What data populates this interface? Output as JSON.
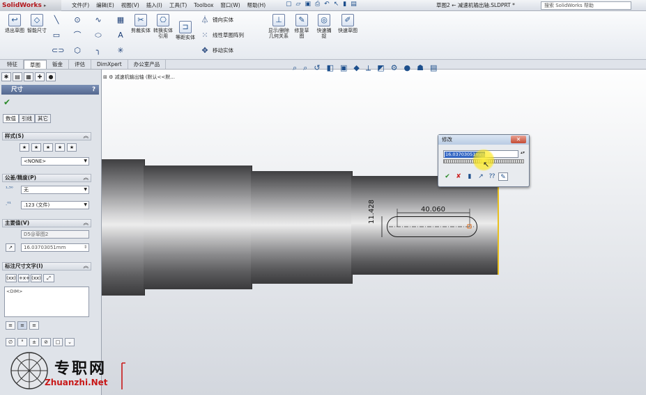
{
  "app": {
    "logo": "SolidWorks",
    "menus": [
      "文件(F)",
      "编辑(E)",
      "视图(V)",
      "插入(I)",
      "工具(T)",
      "Toolbox",
      "窗口(W)",
      "帮助(H)"
    ],
    "document_title": "草图2 ← 减速机输出轴.SLDPRT *",
    "search_placeholder": "搜索 SolidWorks 帮助"
  },
  "ribbon": {
    "exit_sketch": "退出草图",
    "smart_dimension": "智能尺寸",
    "trim": "剪裁实体",
    "convert": "转换实体引用",
    "offset": "等距实体",
    "mirror": "镜向实体",
    "linear_pattern": "线性草图阵列",
    "move": "移动实体",
    "display_relations": "显示/删除几何关系",
    "repair": "修复草图",
    "quick_snaps": "快速捕捉",
    "rapid_sketch": "快速草图"
  },
  "command_tabs": [
    "特征",
    "草图",
    "钣金",
    "评估",
    "DimXpert",
    "办公室产品"
  ],
  "panel": {
    "title": "尺寸",
    "help": "?",
    "subtabs": [
      "数值",
      "引线",
      "其它"
    ],
    "style_section": "样式(S)",
    "style_value": "<NONE>",
    "tolerance_section": "公差/精度(P)",
    "tolerance_type": "无",
    "precision": ".123 (文件)",
    "primary_section": "主要值(V)",
    "primary_name": "D5@草图2",
    "primary_value": "16.03703051mm",
    "dimtext_section": "标注尺寸文字(I)",
    "dimtext_value": "<DIM>",
    "dimtext_buttons": [
      "(xx)",
      "+x+",
      "(xx)"
    ]
  },
  "viewport": {
    "tree_label": "减速机输出轴 (默认<<默..."
  },
  "dimensions": {
    "horizontal": "40.060",
    "vertical": "11.428"
  },
  "dialog": {
    "title": "修改",
    "close": "✕",
    "value": "16.03703051mm"
  },
  "watermark": {
    "text": "专职网",
    "url": "Zhuanzhi.Net"
  },
  "colors": {
    "ok": "#2a8a2a",
    "cancel": "#cc2222",
    "accent": "#3467c4"
  }
}
